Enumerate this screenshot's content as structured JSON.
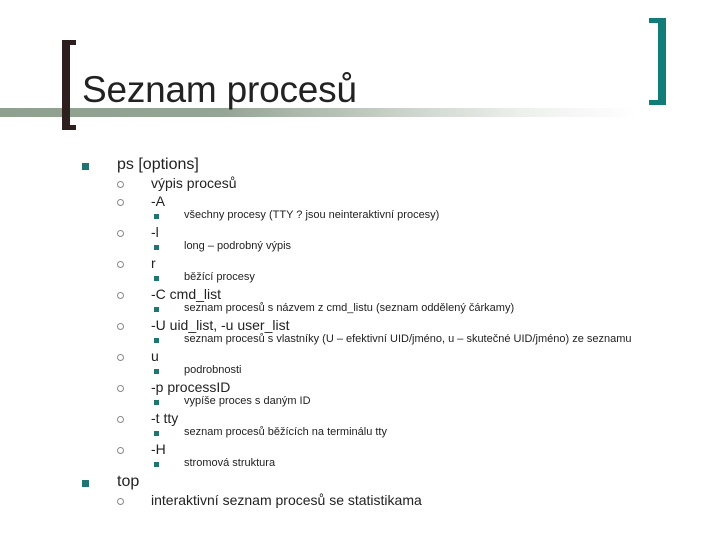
{
  "slide": {
    "title": "Seznam procesů",
    "colors": {
      "left_bracket": "#2d1f1f",
      "right_bracket": "#127c79",
      "bullet": "#1f7570",
      "bar": "#8fa08f"
    },
    "items": [
      {
        "label": "ps [options]",
        "children": [
          {
            "label": "výpis procesů",
            "children": []
          },
          {
            "label": "-A",
            "children": [
              {
                "label": "všechny procesy (TTY ? jsou neinteraktivní procesy)"
              }
            ]
          },
          {
            "label": "-l",
            "children": [
              {
                "label": "long – podrobný výpis"
              }
            ]
          },
          {
            "label": "r",
            "children": [
              {
                "label": "běžící procesy"
              }
            ]
          },
          {
            "label": "-C cmd_list",
            "children": [
              {
                "label": "seznam procesů s názvem z cmd_listu (seznam oddělený čárkamy)"
              }
            ]
          },
          {
            "label": "-U uid_list, -u user_list",
            "children": [
              {
                "label": "seznam procesů s vlastníky (U – efektivní UID/jméno, u – skutečné UID/jméno) ze seznamu"
              }
            ]
          },
          {
            "label": "u",
            "children": [
              {
                "label": "podrobnosti"
              }
            ]
          },
          {
            "label": "-p processID",
            "children": [
              {
                "label": "vypíše proces s daným ID"
              }
            ]
          },
          {
            "label": "-t tty",
            "children": [
              {
                "label": "seznam procesů běžících na terminálu tty"
              }
            ]
          },
          {
            "label": "-H",
            "children": [
              {
                "label": "stromová struktura"
              }
            ]
          }
        ]
      },
      {
        "label": "top",
        "children": [
          {
            "label": "interaktivní seznam procesů se statistikama",
            "children": []
          }
        ]
      }
    ]
  }
}
